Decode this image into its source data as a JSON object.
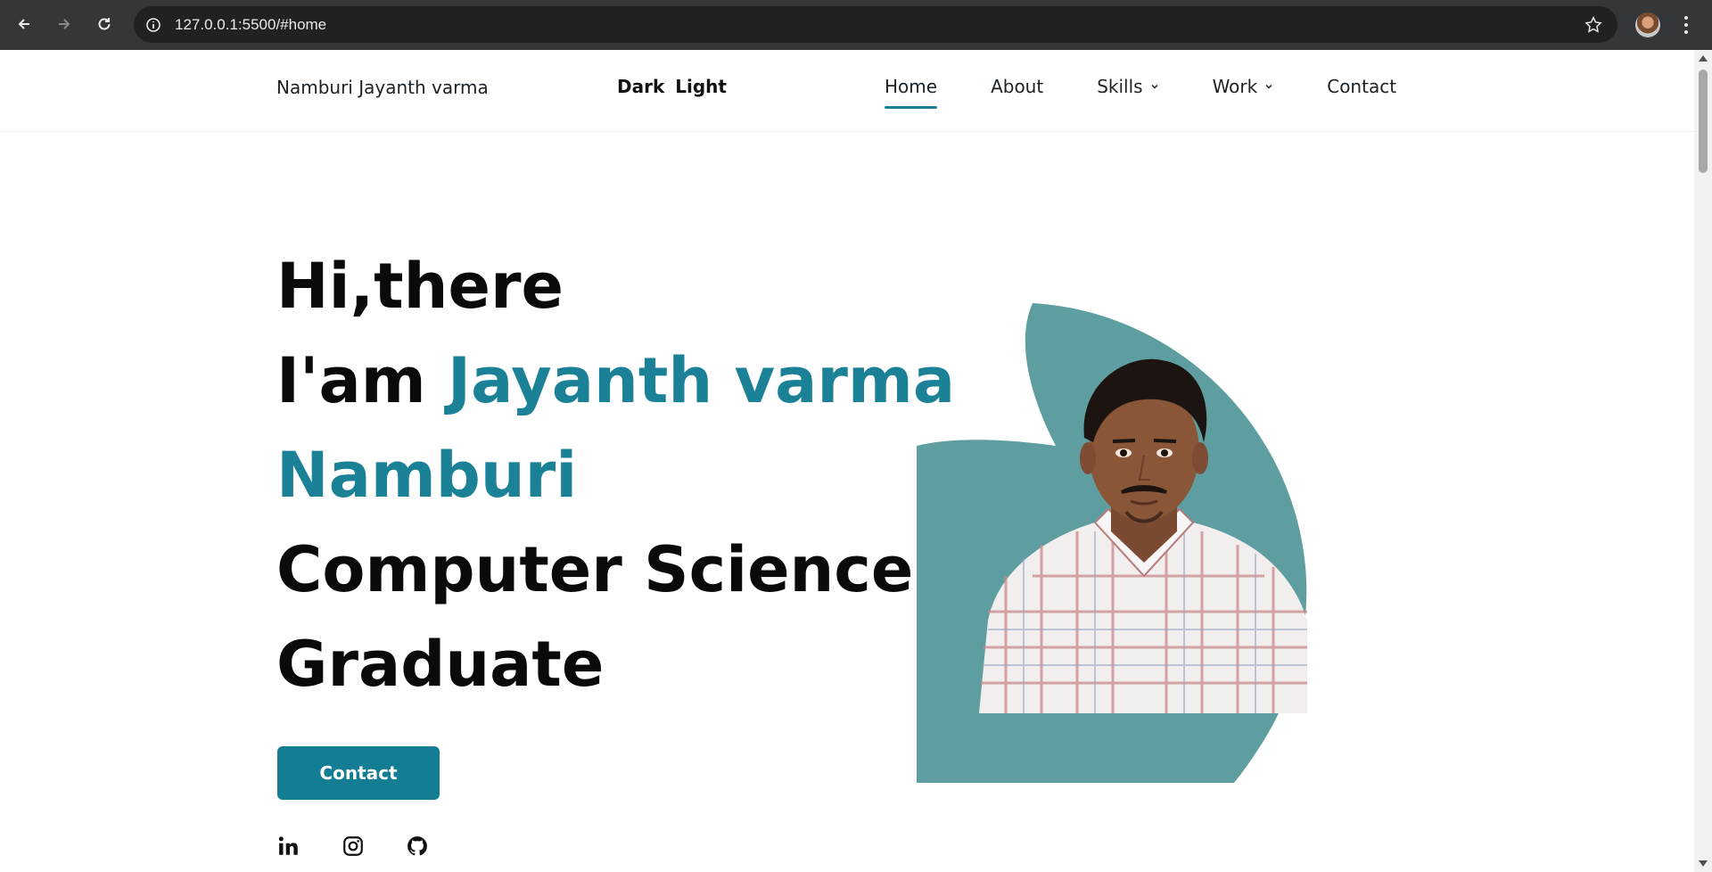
{
  "browser": {
    "url": "127.0.0.1:5500/#home",
    "back_icon": "arrow-left-icon",
    "forward_icon": "arrow-right-icon",
    "reload_icon": "reload-icon",
    "info_icon": "info-icon",
    "bookmark_icon": "star-icon",
    "menu_icon": "kebab-menu-icon"
  },
  "header": {
    "logo": "Namburi Jayanth varma",
    "theme": {
      "dark": "Dark",
      "light": "Light"
    },
    "nav": [
      {
        "label": "Home",
        "active": true,
        "dropdown": false
      },
      {
        "label": "About",
        "active": false,
        "dropdown": false
      },
      {
        "label": "Skills",
        "active": false,
        "dropdown": true
      },
      {
        "label": "Work",
        "active": false,
        "dropdown": true
      },
      {
        "label": "Contact",
        "active": false,
        "dropdown": false
      }
    ]
  },
  "hero": {
    "line1": "Hi,there",
    "line2_prefix": "I'am ",
    "line2_name": "Jayanth varma",
    "line3_name": "Namburi",
    "line4": "Computer Science",
    "line5": "Graduate",
    "cta_label": "Contact"
  },
  "socials": [
    "linkedin-icon",
    "instagram-icon",
    "github-icon"
  ],
  "colors": {
    "accent": "#1a8197",
    "button": "#137e93",
    "blob": "#5f9ea0",
    "chrome_bg": "#35363a",
    "omnibox_bg": "#202124"
  }
}
